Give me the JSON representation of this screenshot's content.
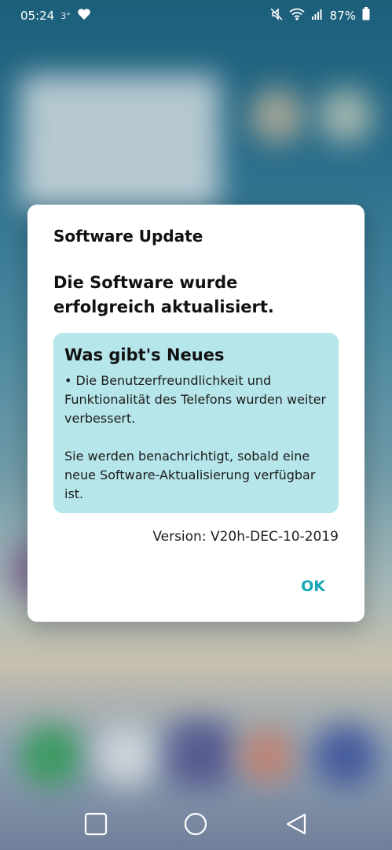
{
  "status_bar": {
    "time": "05:24",
    "temperature": "3°",
    "battery": "87%"
  },
  "dialog": {
    "title": "Software Update",
    "message": "Die Software wurde erfolgreich aktualisiert.",
    "whats_new": {
      "title": "Was gibt's Neues",
      "bullet": "• Die Benutzerfreundlichkeit und Funktionalität des Telefons wurden weiter verbessert.",
      "note": "Sie werden benachrichtigt, sobald eine neue Software-Aktualisierung verfügbar ist."
    },
    "version": "Version: V20h-DEC-10-2019",
    "ok_label": "OK"
  },
  "colors": {
    "accent": "#17a7b5",
    "info_background": "#b6e6ea"
  },
  "icons": {
    "status": [
      "heart-icon",
      "mute-icon",
      "wifi-icon",
      "signal-icon",
      "battery-icon"
    ],
    "nav": [
      "recent-apps-icon",
      "home-icon",
      "back-icon"
    ]
  }
}
